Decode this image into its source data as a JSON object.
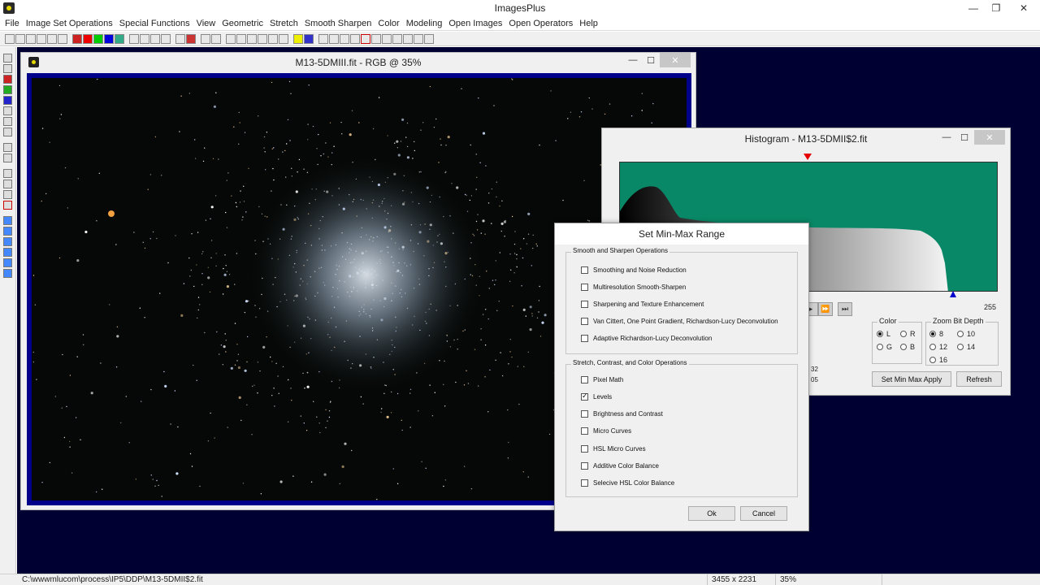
{
  "app": {
    "title": "ImagesPlus",
    "minimize": "—",
    "maximize": "❐",
    "close": "✕"
  },
  "menu": [
    "File",
    "Image Set Operations",
    "Special Functions",
    "View",
    "Geometric",
    "Stretch",
    "Smooth Sharpen",
    "Color",
    "Modeling",
    "Open Images",
    "Open Operators",
    "Help"
  ],
  "image_window": {
    "title": "M13-5DMIII.fit - RGB @ 35%",
    "minimize": "—",
    "maximize": "☐",
    "close": "✕"
  },
  "histogram_window": {
    "title": "Histogram - M13-5DMII$2.fit",
    "minimize": "—",
    "maximize": "☐",
    "close": "✕",
    "max_label": "255",
    "color_group": {
      "title": "Color",
      "options": [
        "L",
        "R",
        "G",
        "B"
      ],
      "selected": "L"
    },
    "zoom_group": {
      "title": "Zoom Bit Depth",
      "options": [
        "8",
        "10",
        "12",
        "14",
        "16"
      ],
      "selected": "8"
    },
    "partial_values": [
      "32",
      "05"
    ],
    "set_min_max_apply_label": "Set Min Max Apply",
    "refresh_label": "Refresh",
    "colors": {
      "plot_bg": "#088866",
      "min_marker": "#e60000",
      "max_marker": "#0000cc"
    }
  },
  "dialog": {
    "title": "Set Min-Max Range",
    "group1": {
      "title": "Smooth and Sharpen Operations",
      "items": [
        {
          "label": "Smoothing and Noise Reduction",
          "checked": false
        },
        {
          "label": "Multiresolution Smooth-Sharpen",
          "checked": false
        },
        {
          "label": "Sharpening and Texture Enhancement",
          "checked": false
        },
        {
          "label": "Van Cittert, One Point Gradient,  Richardson-Lucy Deconvolution",
          "checked": false
        },
        {
          "label": "Adaptive Richardson-Lucy Deconvolution",
          "checked": false
        }
      ]
    },
    "group2": {
      "title": "Stretch, Contrast, and Color Operations",
      "items": [
        {
          "label": "Pixel Math",
          "checked": false
        },
        {
          "label": "Levels",
          "checked": true
        },
        {
          "label": "Brightness and Contrast",
          "checked": false
        },
        {
          "label": "Micro Curves",
          "checked": false
        },
        {
          "label": "HSL Micro Curves",
          "checked": false
        },
        {
          "label": "Additive Color Balance",
          "checked": false
        },
        {
          "label": "Selecive HSL Color Balance",
          "checked": false
        }
      ]
    },
    "ok_label": "Ok",
    "cancel_label": "Cancel"
  },
  "status": {
    "path": "C:\\wwwmlucom\\process\\IP5\\DDP\\M13-5DMII$2.fit",
    "dimensions": "3455 x 2231",
    "zoom": "35%"
  }
}
